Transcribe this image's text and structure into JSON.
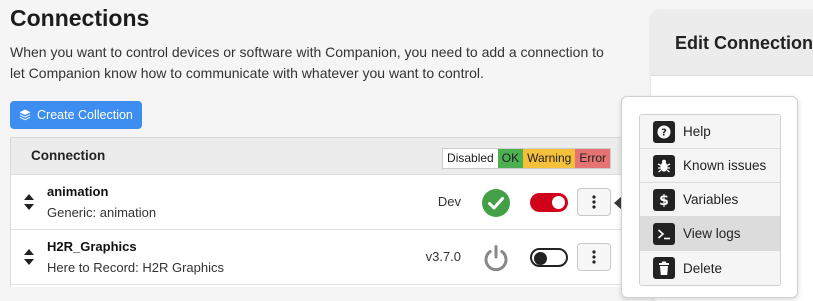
{
  "page": {
    "title": "Connections",
    "description": "When you want to control devices or software with Companion, you need to add a connection to let Companion know how to communicate with whatever you want to control."
  },
  "toolbar": {
    "create_collection_label": "Create Collection",
    "create_collection_icon": "layers-icon"
  },
  "table": {
    "header_label": "Connection",
    "legend": {
      "disabled": "Disabled",
      "ok": "OK",
      "warning": "Warning",
      "error": "Error"
    },
    "rows": [
      {
        "name": "animation",
        "module": "Generic: animation",
        "version": "Dev",
        "status": "ok",
        "enabled": true
      },
      {
        "name": "H2R_Graphics",
        "module": "Here to Record: H2R Graphics",
        "version": "v3.7.0",
        "status": "disabled",
        "enabled": false
      }
    ]
  },
  "edit_panel": {
    "title": "Edit Connection"
  },
  "context_menu": {
    "items": [
      {
        "label": "Help",
        "icon": "question-icon"
      },
      {
        "label": "Known issues",
        "icon": "bug-icon"
      },
      {
        "label": "Variables",
        "icon": "dollar-icon"
      },
      {
        "label": "View logs",
        "icon": "terminal-icon",
        "active": true
      },
      {
        "label": "Delete",
        "icon": "trash-icon"
      }
    ]
  },
  "colors": {
    "primary": "#3d8ef0",
    "ok": "#4caf50",
    "warning": "#f5c03a",
    "error": "#e57373",
    "toggle_on": "#d0021b"
  }
}
